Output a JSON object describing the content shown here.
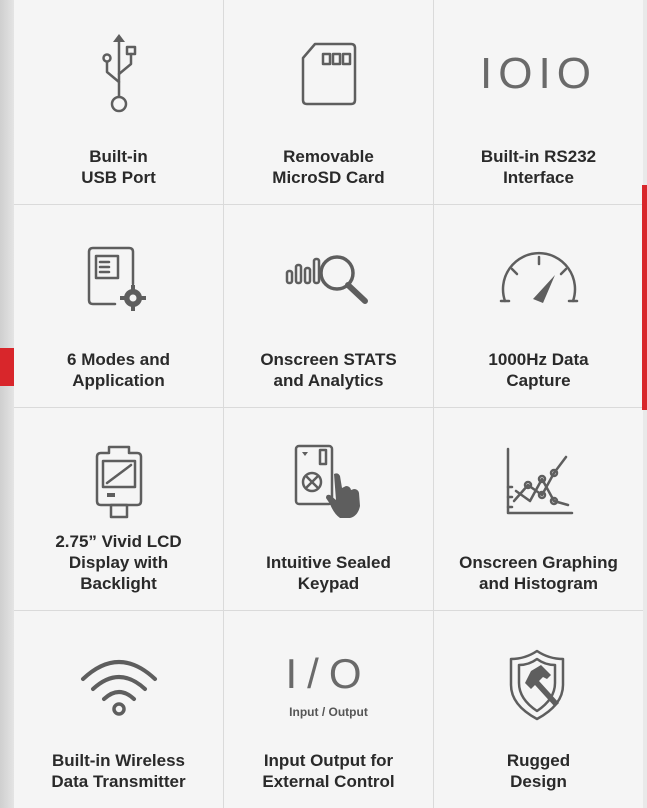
{
  "features": [
    {
      "icon": "usb-icon",
      "label": "Built-in\nUSB Port"
    },
    {
      "icon": "microsd-card-icon",
      "label": "Removable\nMicroSD Card"
    },
    {
      "icon": "rs232-icon",
      "icon_text": "IOIO",
      "label": "Built-in RS232\nInterface"
    },
    {
      "icon": "device-settings-icon",
      "label": "6 Modes and\nApplication"
    },
    {
      "icon": "analytics-icon",
      "label": "Onscreen STATS\nand Analytics"
    },
    {
      "icon": "speedometer-icon",
      "label": "1000Hz Data\nCapture"
    },
    {
      "icon": "lcd-display-icon",
      "label": "2.75” Vivid LCD\nDisplay with\nBacklight"
    },
    {
      "icon": "keypad-icon",
      "label": "Intuitive Sealed\nKeypad"
    },
    {
      "icon": "graph-icon",
      "label": "Onscreen Graphing\nand Histogram"
    },
    {
      "icon": "wifi-icon",
      "label": "Built-in Wireless\nData Transmitter"
    },
    {
      "icon": "input-output-icon",
      "icon_text": "I/O",
      "icon_caption": "Input / Output",
      "label": "Input Output for\nExternal Control"
    },
    {
      "icon": "shield-hammer-icon",
      "label": "Rugged\nDesign"
    }
  ],
  "colors": {
    "accent": "#d8262b",
    "icon": "#5e5e5e",
    "text": "#2a2a2a",
    "panel": "#f5f5f5",
    "divider": "#dadada"
  }
}
